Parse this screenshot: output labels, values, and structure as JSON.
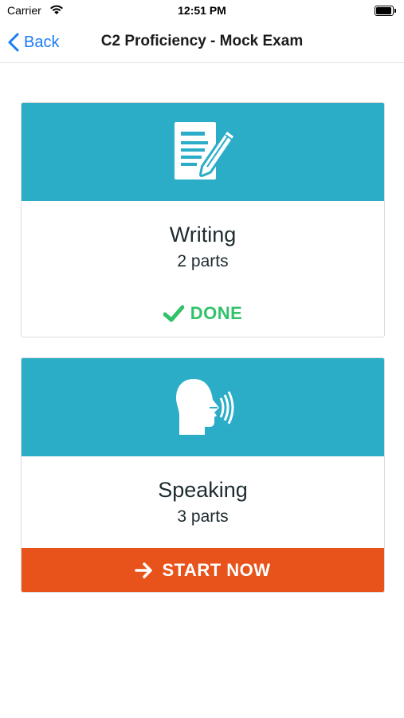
{
  "status_bar": {
    "carrier": "Carrier",
    "time": "12:51 PM"
  },
  "nav": {
    "back_label": "Back",
    "title": "C2 Proficiency - Mock Exam"
  },
  "colors": {
    "banner": "#2badc8",
    "done": "#32c26a",
    "start": "#e7531b",
    "link": "#1a7cf5"
  },
  "sections": [
    {
      "icon": "document-pencil-icon",
      "title": "Writing",
      "parts": "2 parts",
      "status": "DONE"
    },
    {
      "icon": "speaking-head-icon",
      "title": "Speaking",
      "parts": "3 parts",
      "action": "START NOW"
    }
  ]
}
